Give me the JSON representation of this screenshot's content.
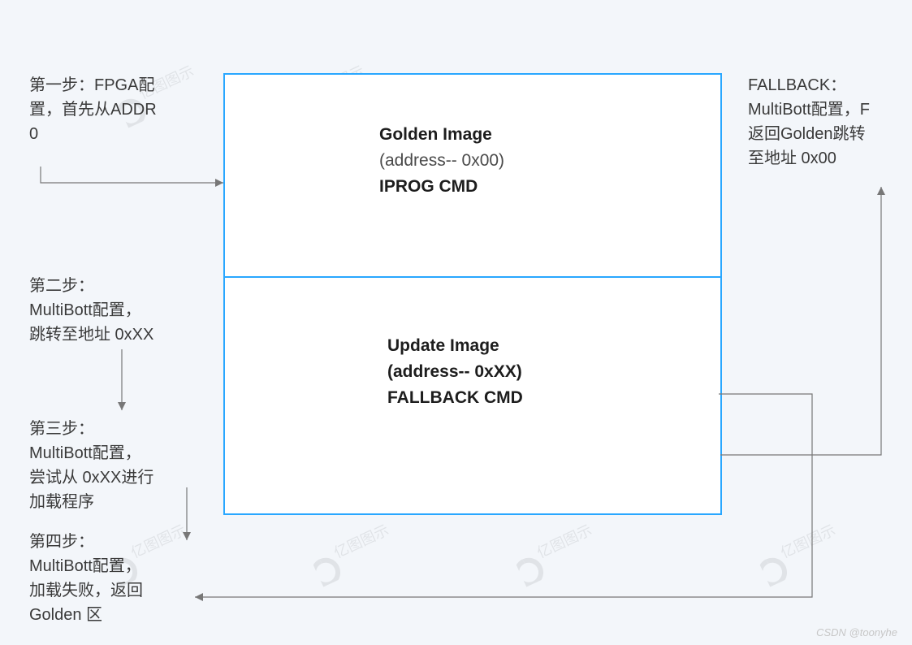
{
  "diagram": {
    "golden": {
      "title": "Golden Image",
      "addr": "(address--  0x00)",
      "cmd": "IPROG  CMD"
    },
    "update": {
      "title": "Update Image",
      "addr": "(address--  0xXX)",
      "cmd": "FALLBACK CMD"
    }
  },
  "steps": {
    "s1": {
      "line1": "第一步：FPGA配",
      "line2": "置，首先从ADDR",
      "line3": "0"
    },
    "s2": {
      "line1": "第二步：",
      "line2": "MultiBott配置，",
      "line3": "跳转至地址 0xXX"
    },
    "s3": {
      "line1": "第三步：",
      "line2": "MultiBott配置，",
      "line3": "尝试从 0xXX进行",
      "line4": "加载程序"
    },
    "s4": {
      "line1": "第四步：",
      "line2": "MultiBott配置，",
      "line3": "加载失败，返回",
      "line4": "Golden 区"
    }
  },
  "fallback": {
    "line1": "FALLBACK：",
    "line2": "MultiBott配置，F",
    "line3": "返回Golden跳转",
    "line4": "至地址 0x00"
  },
  "credit": "CSDN @toonyhe",
  "watermark": "亿图图示"
}
